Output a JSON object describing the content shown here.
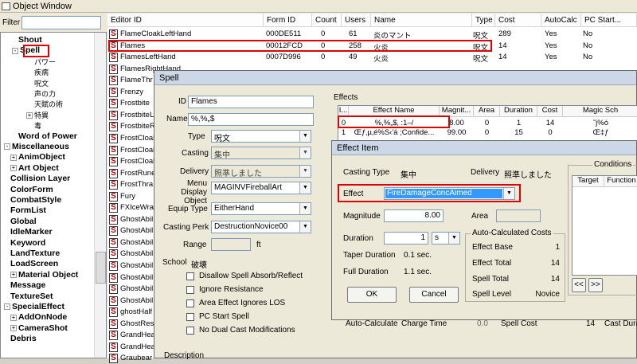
{
  "object_window": {
    "title": "Object Window",
    "filter_label": "Filter",
    "tree": [
      {
        "label": "Shout",
        "pm": ""
      },
      {
        "label": "Spell",
        "pm": "-"
      },
      {
        "label": "パワー",
        "pm": ""
      },
      {
        "label": "疾病",
        "pm": ""
      },
      {
        "label": "呪文",
        "pm": ""
      },
      {
        "label": "声の力",
        "pm": ""
      },
      {
        "label": "天賦の術",
        "pm": ""
      },
      {
        "label": "特異",
        "pm": "+"
      },
      {
        "label": "毒",
        "pm": ""
      },
      {
        "label": "Word of Power",
        "pm": ""
      },
      {
        "label": "Miscellaneous",
        "pm": "-"
      },
      {
        "label": "AnimObject",
        "pm": "+"
      },
      {
        "label": "Art Object",
        "pm": "+"
      },
      {
        "label": "Collision Layer",
        "pm": ""
      },
      {
        "label": "ColorForm",
        "pm": ""
      },
      {
        "label": "CombatStyle",
        "pm": ""
      },
      {
        "label": "FormList",
        "pm": ""
      },
      {
        "label": "Global",
        "pm": ""
      },
      {
        "label": "IdleMarker",
        "pm": ""
      },
      {
        "label": "Keyword",
        "pm": ""
      },
      {
        "label": "LandTexture",
        "pm": ""
      },
      {
        "label": "LoadScreen",
        "pm": ""
      },
      {
        "label": "Material Object",
        "pm": "+"
      },
      {
        "label": "Message",
        "pm": ""
      },
      {
        "label": "TextureSet",
        "pm": ""
      },
      {
        "label": "SpecialEffect",
        "pm": "-"
      },
      {
        "label": "AddOnNode",
        "pm": "+"
      },
      {
        "label": "CameraShot",
        "pm": "+"
      },
      {
        "label": "Debris",
        "pm": ""
      }
    ],
    "columns": [
      "Editor ID",
      "Form ID",
      "Count",
      "Users",
      "Name",
      "Type",
      "Cost",
      "AutoCalc",
      "PC Start..."
    ],
    "rows": [
      [
        "FlameCloakLeftHand",
        "000DE511",
        "0",
        "61",
        "炎のマント",
        "呪文",
        "289",
        "Yes",
        "No"
      ],
      [
        "Flames",
        "00012FCD",
        "0",
        "258",
        "火炎",
        "呪文",
        "14",
        "Yes",
        "No"
      ],
      [
        "FlamesLeftHand",
        "0007D996",
        "0",
        "49",
        "火炎",
        "呪文",
        "14",
        "Yes",
        "No"
      ],
      [
        "FlamesRightHand",
        "",
        "",
        "",
        "",
        "",
        "",
        "",
        ""
      ],
      [
        "FlameThr",
        "",
        "",
        "",
        "",
        "",
        "",
        "",
        ""
      ],
      [
        "Frenzy",
        "",
        "",
        "",
        "",
        "",
        "",
        "",
        ""
      ],
      [
        "Frostbite",
        "",
        "",
        "",
        "",
        "",
        "",
        "",
        ""
      ],
      [
        "FrostbiteL",
        "",
        "",
        "",
        "",
        "",
        "",
        "",
        ""
      ],
      [
        "FrostbiteR",
        "",
        "",
        "",
        "",
        "",
        "",
        "",
        ""
      ],
      [
        "FrostCloak",
        "",
        "",
        "",
        "",
        "",
        "",
        "",
        ""
      ],
      [
        "FrostCloak",
        "",
        "",
        "",
        "",
        "",
        "",
        "",
        ""
      ],
      [
        "FrostCloak",
        "",
        "",
        "",
        "",
        "",
        "",
        "",
        ""
      ],
      [
        "FrostRune",
        "",
        "",
        "",
        "",
        "",
        "",
        "",
        ""
      ],
      [
        "FrostThra",
        "",
        "",
        "",
        "",
        "",
        "",
        "",
        ""
      ],
      [
        "Fury",
        "",
        "",
        "",
        "",
        "",
        "",
        "",
        ""
      ],
      [
        "FXIceWra",
        "",
        "",
        "",
        "",
        "",
        "",
        "",
        ""
      ],
      [
        "GhostAbil",
        "",
        "",
        "",
        "",
        "",
        "",
        "",
        ""
      ],
      [
        "GhostAbil",
        "",
        "",
        "",
        "",
        "",
        "",
        "",
        ""
      ],
      [
        "GhostAbil",
        "",
        "",
        "",
        "",
        "",
        "",
        "",
        ""
      ],
      [
        "GhostAbil",
        "",
        "",
        "",
        "",
        "",
        "",
        "",
        ""
      ],
      [
        "GhostAbil",
        "",
        "",
        "",
        "",
        "",
        "",
        "",
        ""
      ],
      [
        "GhostAbil",
        "",
        "",
        "",
        "",
        "",
        "",
        "",
        ""
      ],
      [
        "GhostAbil",
        "",
        "",
        "",
        "",
        "",
        "",
        "",
        ""
      ],
      [
        "GhostAbil",
        "",
        "",
        "",
        "",
        "",
        "",
        "",
        ""
      ],
      [
        "ghostHalf",
        "",
        "",
        "",
        "",
        "",
        "",
        "",
        ""
      ],
      [
        "GhostRes",
        "",
        "",
        "",
        "",
        "",
        "",
        "",
        ""
      ],
      [
        "GrandHea",
        "",
        "",
        "",
        "",
        "",
        "",
        "",
        ""
      ],
      [
        "GrandHea",
        "",
        "",
        "",
        "",
        "",
        "",
        "",
        ""
      ],
      [
        "Graubear",
        "",
        "",
        "",
        "",
        "",
        "",
        "",
        ""
      ]
    ]
  },
  "spell": {
    "title": "Spell",
    "id_label": "ID",
    "id_value": "Flames",
    "name_label": "Name",
    "name_value": "%,%„$",
    "type_label": "Type",
    "type_value": "呪文",
    "casting_label": "Casting",
    "casting_value": "集中",
    "delivery_label": "Delivery",
    "delivery_value": "照準しました",
    "menu_display_label": "Menu Display Object",
    "menu_display_value": "MAGINVFireballArt",
    "equip_type_label": "Equip Type",
    "equip_type_value": "EitherHand",
    "casting_perk_label": "Casting Perk",
    "casting_perk_value": "DestructionNovice00",
    "range_label": "Range",
    "range_unit": "ft",
    "school_label": "School",
    "school_value": "破壊",
    "checks": [
      "Disallow Spell Absorb/Reflect",
      "Ignore Resistance",
      "Area Effect Ignores LOS",
      "PC Start Spell",
      "No Dual Cast Modifications"
    ],
    "description_label": "Description",
    "effects_label": "Effects",
    "effects_columns": [
      "I...",
      "Effect Name",
      "Magnit...",
      "Area",
      "Duration",
      "Cost",
      "Magic Sch"
    ],
    "effects_rows": [
      [
        "0",
        "%,%„$‚ :1–/",
        "8.00",
        "0",
        "1",
        "14",
        "˜j%ó"
      ],
      [
        "1",
        "Œƒ‚µ‚é%S‹'á ;Confide...",
        "99.00",
        "0",
        "15",
        "0",
        "Œ‡ƒ"
      ]
    ],
    "bottom": {
      "autocalc": "Auto-Calculate",
      "charge_time": "Charge Time",
      "charge_value": "0.0",
      "spell_cost": "Spell Cost",
      "spell_cost_value": "14",
      "cast_duration": "Cast Duration"
    }
  },
  "effect_item": {
    "title": "Effect Item",
    "casting_type_label": "Casting Type",
    "casting_type_value": "集中",
    "delivery_label": "Delivery",
    "delivery_value": "照準しました",
    "effect_label": "Effect",
    "effect_value": "FireDamageConcAimed",
    "magnitude_label": "Magnitude",
    "magnitude_value": "8.00",
    "area_label": "Area",
    "duration_label": "Duration",
    "duration_value": "1",
    "duration_unit": "s",
    "taper_duration_label": "Taper Duration",
    "taper_duration_value": "0.1 sec.",
    "full_duration_label": "Full Duration",
    "full_duration_value": "1.1 sec.",
    "ok_label": "OK",
    "cancel_label": "Cancel",
    "auto_costs": {
      "title": "Auto-Calculated Costs",
      "effect_base_label": "Effect Base",
      "effect_base_value": "1",
      "effect_total_label": "Effect Total",
      "effect_total_value": "14",
      "spell_total_label": "Spell Total",
      "spell_total_value": "14",
      "spell_level_label": "Spell Level",
      "spell_level_value": "Novice"
    },
    "conditions": {
      "title": "Conditions",
      "col_target": "Target",
      "col_function": "Function",
      "prev_label": "<<",
      "next_label": ">>"
    }
  },
  "colors": {
    "highlight": "#e00000",
    "selection": "#3399ff"
  }
}
